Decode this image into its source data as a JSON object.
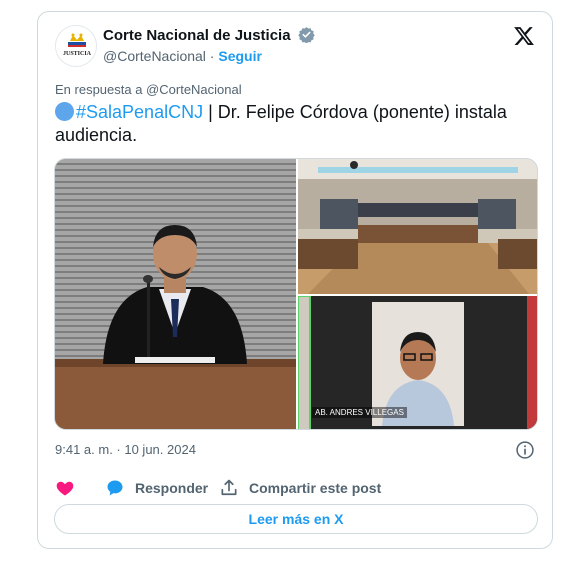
{
  "author": {
    "name": "Corte Nacional de Justicia",
    "handle": "@CorteNacional",
    "separator": " · ",
    "follow_label": "Seguir",
    "logo_text": "JUSTICIA"
  },
  "tweet": {
    "reply_to": "En respuesta a @CorteNacional",
    "hashtag": "#SalaPenalCNJ",
    "text": " | Dr. Felipe Córdova (ponente) instala audiencia."
  },
  "media": {
    "caption_participant": "AB. ANDRES VILLEGAS"
  },
  "timestamp": "9:41 a. m. · 10 jun. 2024",
  "actions": {
    "reply_label": "Responder",
    "share_label": "Compartir este post"
  },
  "read_more_label": "Leer más en X",
  "colors": {
    "accent": "#1d9bf0",
    "like": "#f91880",
    "border": "#cfd9de",
    "muted": "#536471"
  }
}
